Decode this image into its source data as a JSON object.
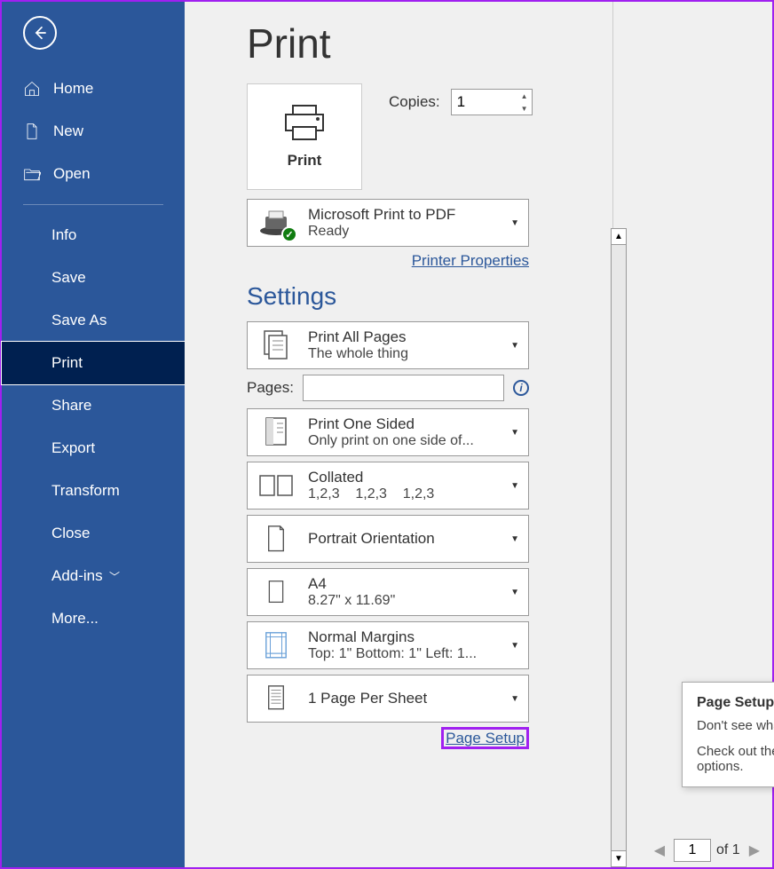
{
  "sidebar": {
    "home": "Home",
    "new": "New",
    "open": "Open",
    "items": [
      "Info",
      "Save",
      "Save As",
      "Print",
      "Share",
      "Export",
      "Transform",
      "Close",
      "Add-ins",
      "More..."
    ],
    "active_index": 3,
    "addins_has_chevron": true
  },
  "page_title": "Print",
  "print_button_label": "Print",
  "copies": {
    "label": "Copies:",
    "value": "1"
  },
  "printer": {
    "name": "Microsoft Print to PDF",
    "status": "Ready",
    "properties_link": "Printer Properties"
  },
  "settings_title": "Settings",
  "settings": {
    "print_what": {
      "title": "Print All Pages",
      "sub": "The whole thing"
    },
    "pages_label": "Pages:",
    "pages_value": "",
    "sides": {
      "title": "Print One Sided",
      "sub": "Only print on one side of..."
    },
    "collate": {
      "title": "Collated",
      "sub": "1,2,3    1,2,3    1,2,3"
    },
    "orientation": {
      "title": "Portrait Orientation"
    },
    "paper": {
      "title": "A4",
      "sub": "8.27\" x 11.69\""
    },
    "margins": {
      "title": "Normal Margins",
      "sub": "Top: 1\" Bottom: 1\" Left: 1..."
    },
    "per_sheet": {
      "title": "1 Page Per Sheet"
    }
  },
  "page_setup_link": "Page Setup",
  "tooltip": {
    "title": "Page Setup",
    "line1": "Don't see what you're looking for?",
    "line2": "Check out the full set of page formatting options."
  },
  "footer": {
    "page": "1",
    "of_text": "of 1"
  }
}
